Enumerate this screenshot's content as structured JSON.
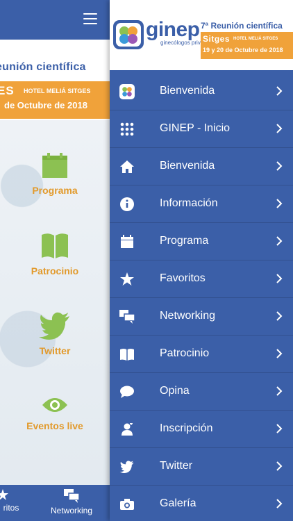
{
  "underlying": {
    "banner": {
      "reunion_text": "eunión científica",
      "sitges_text": "ES",
      "hotel_text": "HOTEL MELIÁ SITGES",
      "dates_text": "de Octubre de 2018"
    },
    "tiles": [
      {
        "label": "Programa",
        "icon": "calendar-icon"
      },
      {
        "label": "Patrocinio",
        "icon": "book-icon"
      },
      {
        "label": "Twitter",
        "icon": "twitter-bird-icon"
      },
      {
        "label": "Eventos live",
        "icon": "eye-icon"
      }
    ],
    "bottom_bar": {
      "left_label": "ritos",
      "right_label": "Networking"
    }
  },
  "drawer": {
    "header": {
      "logo_text": "ginep",
      "logo_sub": "ginecólogos privados",
      "reunion": "7ª Reunión científica",
      "sitges": "Sitges",
      "hotel": "HOTEL MELIÁ SITGES",
      "dates": "19 y 20 de Octubre de 2018"
    },
    "items": [
      {
        "label": "Bienvenida",
        "icon": "ginep-logo-icon"
      },
      {
        "label": "GINEP - Inicio",
        "icon": "grid-icon"
      },
      {
        "label": "Bienvenida",
        "icon": "home-icon"
      },
      {
        "label": "Información",
        "icon": "info-icon"
      },
      {
        "label": "Programa",
        "icon": "calendar-icon"
      },
      {
        "label": "Favoritos",
        "icon": "star-icon"
      },
      {
        "label": "Networking",
        "icon": "chat-bubbles-icon"
      },
      {
        "label": "Patrocinio",
        "icon": "book-icon"
      },
      {
        "label": "Opina",
        "icon": "speech-bubble-icon"
      },
      {
        "label": "Inscripción",
        "icon": "user-icon"
      },
      {
        "label": "Twitter",
        "icon": "twitter-icon"
      },
      {
        "label": "Galería",
        "icon": "camera-icon"
      }
    ]
  },
  "colors": {
    "primary": "#3b5fa8",
    "accent_orange": "#f0a23a",
    "tile_green": "#8cc152",
    "tile_label": "#e29a2c"
  }
}
